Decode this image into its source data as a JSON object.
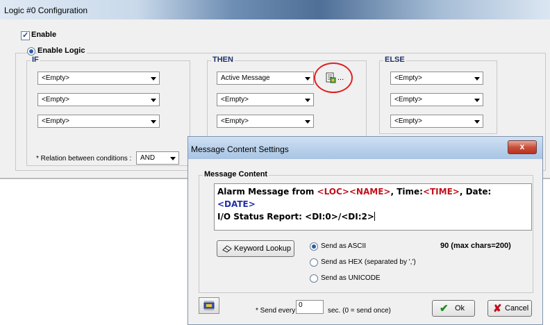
{
  "logic_window": {
    "title": "Logic #0 Configuration",
    "enable_label": "Enable",
    "enable_logic_label": "Enable Logic",
    "if_label": "IF",
    "then_label": "THEN",
    "else_label": "ELSE",
    "if_conditions": [
      "<Empty>",
      "<Empty>",
      "<Empty>"
    ],
    "then_actions": [
      "Active Message",
      "<Empty>",
      "<Empty>"
    ],
    "else_actions": [
      "<Empty>",
      "<Empty>",
      "<Empty>"
    ],
    "relation_label": "* Relation between conditions :",
    "relation_value": "AND",
    "wizard_ellipsis": "..."
  },
  "dialog": {
    "title": "Message Content Settings",
    "close_label": "x",
    "group_label": "Message Content",
    "message_line1": {
      "prefix": "Alarm Message from ",
      "loc": "<LOC>",
      "name": "<NAME>",
      "mid": ", Time:",
      "time": "<TIME>",
      "mid2": ", Date:",
      "date": "<DATE>"
    },
    "message_line2": "I/O Status Report: <DI:0>/<DI:2>",
    "keyword_lookup_label": "Keyword Lookup",
    "send_ascii_label": "Send as ASCII",
    "send_hex_label": "Send as HEX (separated by ',')",
    "send_unicode_label": "Send as UNICODE",
    "char_count": "90 (max chars=200)",
    "send_every_label": "* Send every",
    "send_every_value": "0",
    "send_every_suffix": "sec. (0 = send once)",
    "ok_label": "Ok",
    "cancel_label": "Cancel"
  },
  "colors": {
    "keyword_red": "#c0111d",
    "keyword_blue": "#1f2fa8",
    "highlight_circle": "#e02020"
  }
}
